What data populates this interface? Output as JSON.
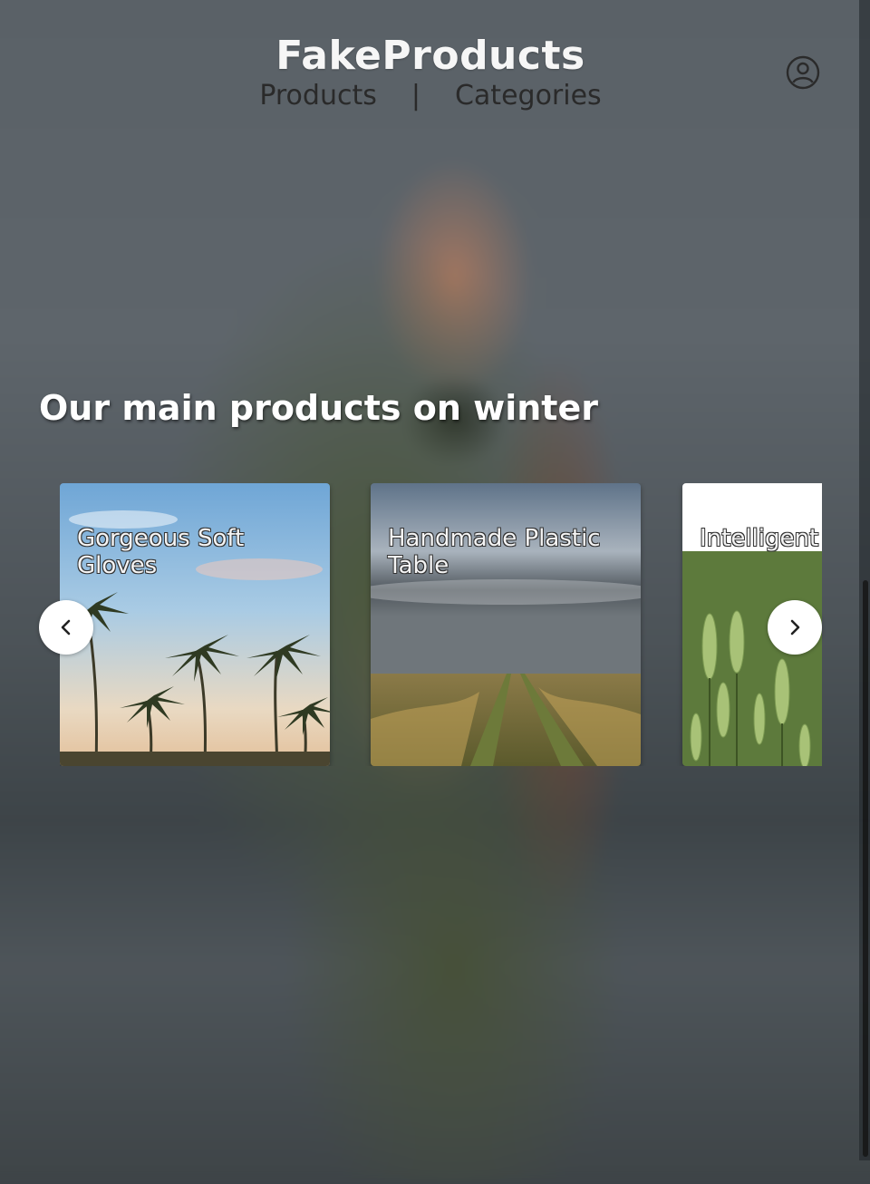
{
  "app": {
    "brand": "FakeProducts",
    "nav": {
      "products": "Products",
      "separator": "|",
      "categories": "Categories"
    }
  },
  "hero": {
    "title": "Our main products on winter"
  },
  "carousel": {
    "cards": [
      {
        "title": "Gorgeous Soft Gloves",
        "image": "palm-trees"
      },
      {
        "title": "Handmade Plastic Table",
        "image": "field-road"
      },
      {
        "title": "Intelligent Gloves",
        "image": "wheat-field"
      }
    ],
    "prev_icon": "chevron-left-icon",
    "next_icon": "chevron-right-icon"
  },
  "icons": {
    "account": "user-circle-icon"
  }
}
